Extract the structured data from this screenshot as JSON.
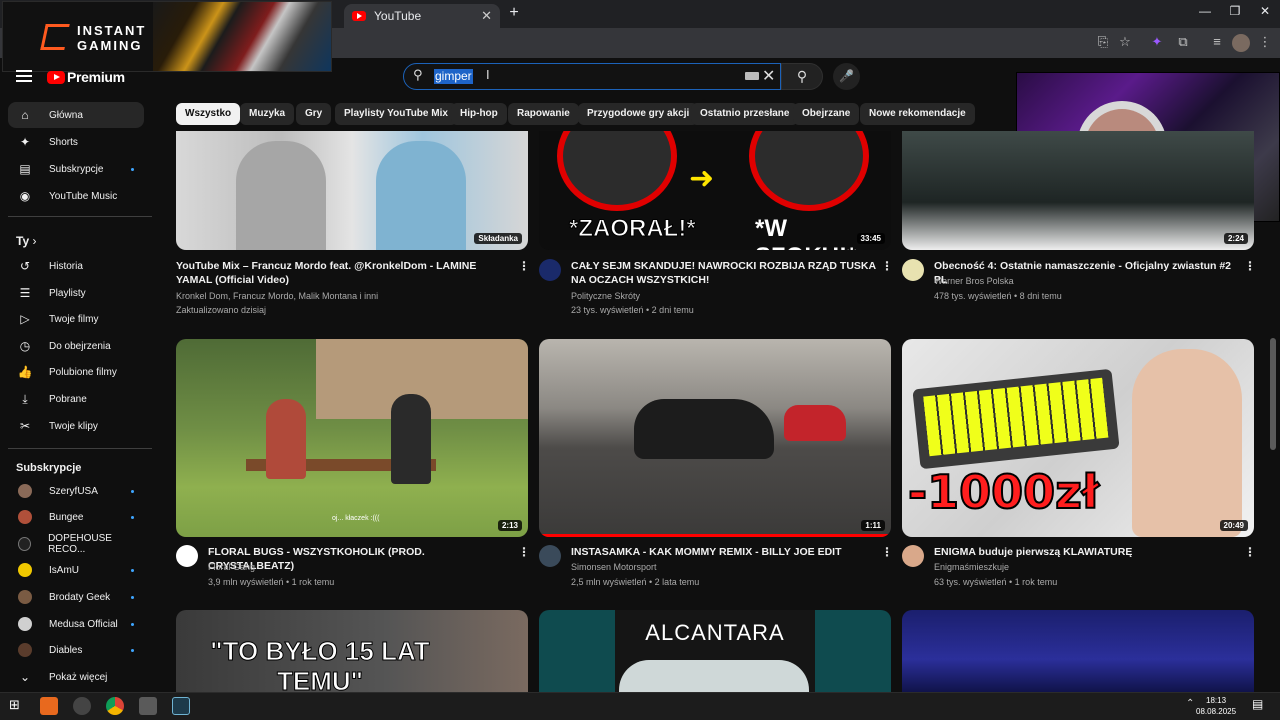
{
  "browser": {
    "tab_title": "YouTube",
    "tab_close": "✕",
    "new_tab": "+",
    "window_controls": [
      "—",
      "❐",
      "✕"
    ]
  },
  "overlay": {
    "brand_line1": "INSTANT",
    "brand_line2": "GAMING"
  },
  "header": {
    "logo_text": "Premium",
    "search_value": "gimper",
    "search_icon": "search-icon",
    "mic_icon": "mic-icon"
  },
  "sidebar": {
    "main": [
      {
        "label": "Główna",
        "icon": "⌂"
      },
      {
        "label": "Shorts",
        "icon": "✦"
      },
      {
        "label": "Subskrypcje",
        "icon": "▤"
      },
      {
        "label": "YouTube Music",
        "icon": "◉"
      }
    ],
    "you_heading": "Ty",
    "you_items": [
      {
        "label": "Historia",
        "icon": "↺"
      },
      {
        "label": "Playlisty",
        "icon": "☰"
      },
      {
        "label": "Twoje filmy",
        "icon": "▷"
      },
      {
        "label": "Do obejrzenia",
        "icon": "◷"
      },
      {
        "label": "Polubione filmy",
        "icon": "👍"
      },
      {
        "label": "Pobrane",
        "icon": "⤓"
      },
      {
        "label": "Twoje klipy",
        "icon": "✂"
      }
    ],
    "subs_heading": "Subskrypcje",
    "subscriptions": [
      {
        "label": "SzeryfUSA",
        "color": "#8a6a58",
        "dot": true
      },
      {
        "label": "Bungee",
        "color": "#b0503a",
        "dot": true
      },
      {
        "label": "DOPEHOUSE RECO...",
        "color": "#222222",
        "dot": false
      },
      {
        "label": "IsAmU",
        "color": "#f0c800",
        "dot": true
      },
      {
        "label": "Brodaty Geek",
        "color": "#7a5b43",
        "dot": true
      },
      {
        "label": "Medusa Official",
        "color": "#d0d0d0",
        "dot": true
      },
      {
        "label": "Diables",
        "color": "#5a3c2c",
        "dot": true
      }
    ],
    "show_more": "Pokaż więcej"
  },
  "chips": [
    "Wszystko",
    "Muzyka",
    "Gry",
    "Playlisty YouTube Mix",
    "Hip-hop",
    "Rapowanie",
    "Przygodowe gry akcji",
    "Ostatnio przesłane",
    "Obejrzane",
    "Nowe rekomendacje"
  ],
  "videos_row1": [
    {
      "title": "YouTube Mix – Francuz Mordo feat. @KronkelDom  - LAMINE YAMAL (Official Video)",
      "channel": "Kronkel Dom, Francuz Mordo, Malik Montana i inni",
      "meta": "Zaktualizowano dzisiaj",
      "badge": "Składanka"
    },
    {
      "title": "CAŁY SEJM SKANDUJE! NAWROCKI ROZBIJA RZĄD TUSKA NA OCZACH WSZYSTKICH!",
      "channel": "Polityczne Skróty",
      "meta": "23 tys. wyświetleń • 2 dni temu",
      "duration": "33:45",
      "thumb_text_left": "*ZAORAŁ!*",
      "thumb_text_right": "*W SZOKU!*"
    },
    {
      "title": "Obecność 4: Ostatnie namaszczenie - Oficjalny zwiastun #2 PL",
      "channel": "Warner Bros Polska",
      "meta": "478 tys. wyświetleń • 8 dni temu",
      "duration": "2:24"
    }
  ],
  "videos_row2": [
    {
      "title": "FLORAL BUGS - WSZYSTKOHOLIK (PROD. CRYSTALBEATZ)",
      "channel": "Floral Gang",
      "meta": "3,9 mln wyświetleń • 1 rok temu",
      "duration": "2:13",
      "caption": "oj... kłaczek :((("
    },
    {
      "title": "INSTASAMKA - KAK MOMMY REMIX - BILLY JOE EDIT",
      "channel": "Simonsen Motorsport",
      "meta": "2,5 mln wyświetleń • 2 lata temu",
      "duration": "1:11"
    },
    {
      "title": "ENIGMA buduje pierwszą KLAWIATURĘ",
      "channel": "Enigmaśmieszkuje",
      "meta": "63 tys. wyświetleń • 1 rok temu",
      "duration": "20:49",
      "thumb_text": "-1000zł"
    }
  ],
  "videos_row3": [
    {
      "thumb_text": "\"TO BYŁO 15 LAT TEMU\""
    },
    {
      "thumb_text": "ALCANTARA"
    },
    {
      "thumb_text": ""
    }
  ],
  "taskbar": {
    "time": "18:13",
    "date": "08.08.2025"
  }
}
